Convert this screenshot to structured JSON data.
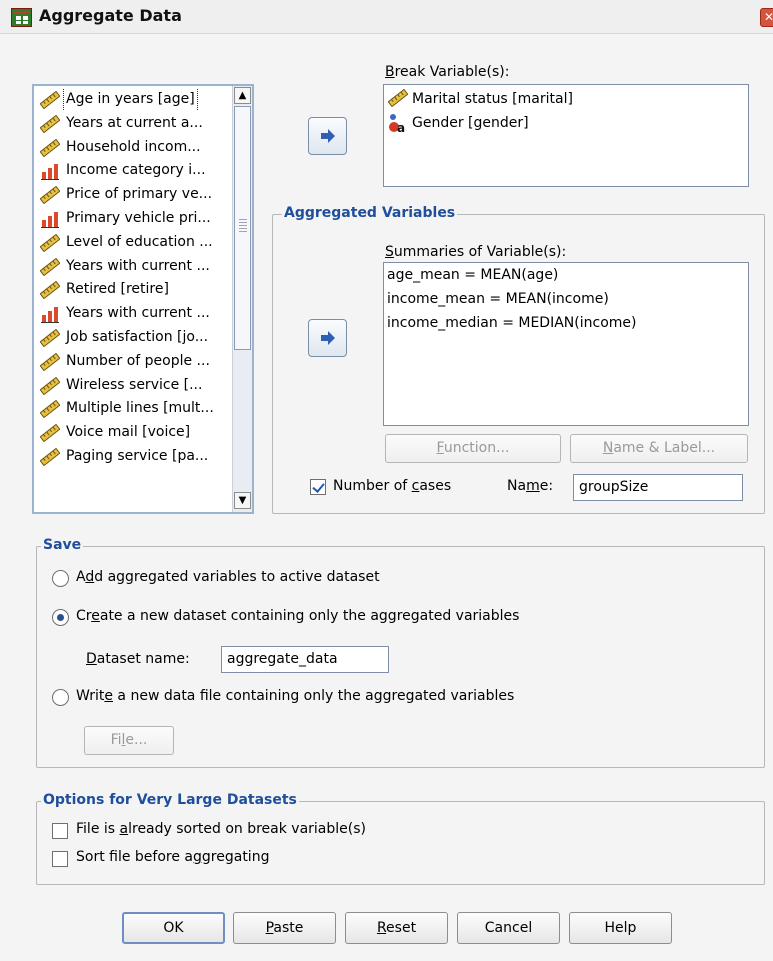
{
  "window": {
    "title": "Aggregate Data",
    "close_glyph": "✕"
  },
  "source_variables": [
    {
      "label": "Age in years [age]",
      "icon": "scale-ruler-icon",
      "selected": true
    },
    {
      "label": "Years at current a...",
      "icon": "scale-ruler-icon"
    },
    {
      "label": "Household incom...",
      "icon": "scale-ruler-icon"
    },
    {
      "label": "Income category i...",
      "icon": "ordinal-bars-icon"
    },
    {
      "label": "Price of primary ve...",
      "icon": "scale-ruler-icon"
    },
    {
      "label": "Primary vehicle pri...",
      "icon": "ordinal-bars-icon"
    },
    {
      "label": "Level of education ...",
      "icon": "scale-ruler-icon"
    },
    {
      "label": "Years with current ...",
      "icon": "scale-ruler-icon"
    },
    {
      "label": "Retired [retire]",
      "icon": "scale-ruler-icon"
    },
    {
      "label": "Years with current ...",
      "icon": "ordinal-bars-icon"
    },
    {
      "label": "Job satisfaction [jo...",
      "icon": "scale-ruler-icon"
    },
    {
      "label": "Number of people ...",
      "icon": "scale-ruler-icon"
    },
    {
      "label": "Wireless service [...",
      "icon": "scale-ruler-icon"
    },
    {
      "label": "Multiple lines [mult...",
      "icon": "scale-ruler-icon"
    },
    {
      "label": "Voice mail [voice]",
      "icon": "scale-ruler-icon"
    },
    {
      "label": "Paging service [pa...",
      "icon": "scale-ruler-icon"
    }
  ],
  "break_variables": {
    "label_prefix": "",
    "label_mnemonic": "B",
    "label_rest": "reak Variable(s):",
    "items": [
      {
        "label": "Marital status [marital]",
        "icon": "scale-ruler-icon"
      },
      {
        "label": "Gender [gender]",
        "icon": "nominal-gender-icon"
      }
    ]
  },
  "aggregated": {
    "group_title": "Aggregated Variables",
    "summaries_mnemonic": "S",
    "summaries_rest": "ummaries of Variable(s):",
    "items": [
      "age_mean = MEAN(age)",
      "income_mean = MEAN(income)",
      "income_median = MEDIAN(income)"
    ],
    "function_mnemonic": "F",
    "function_rest": "unction...",
    "name_label_mnemonic": "N",
    "name_label_rest": "ame & Label...",
    "number_of_cases_pre": "Number of ",
    "number_of_cases_mnemonic": "c",
    "number_of_cases_post": "ases",
    "number_of_cases_checked": true,
    "name_pre": "Na",
    "name_mnemonic": "m",
    "name_post": "e:",
    "name_value": "groupSize"
  },
  "save": {
    "group_title": "Save",
    "opt1_pre": "A",
    "opt1_mnemonic": "d",
    "opt1_post": "d aggregated variables to active dataset",
    "opt2_pre": "Cr",
    "opt2_mnemonic": "e",
    "opt2_post": "ate a new dataset containing only the aggregated variables",
    "dataset_name_mnemonic": "D",
    "dataset_name_rest": "ataset name:",
    "dataset_name_value": "aggregate_data",
    "opt3_pre": "Writ",
    "opt3_mnemonic": "e",
    "opt3_post": " a new data file containing only the aggregated variables",
    "file_pre": "Fi",
    "file_mnemonic": "l",
    "file_post": "e...",
    "selected_option": 2
  },
  "large": {
    "group_title": "Options for Very Large Datasets",
    "opt1_pre": "File is ",
    "opt1_mnemonic": "a",
    "opt1_post": "lready sorted on break variable(s)",
    "opt2_pre": "Sort file before a",
    "opt2_mnemonic": "g",
    "opt2_post": "gregating"
  },
  "buttons": {
    "ok": "OK",
    "paste_mnemonic": "P",
    "paste_rest": "aste",
    "reset_mnemonic": "R",
    "reset_rest": "eset",
    "cancel": "Cancel",
    "help": "Help"
  },
  "colors": {
    "accent": "#1f4e9a",
    "list_border": "#9bb3cf"
  }
}
